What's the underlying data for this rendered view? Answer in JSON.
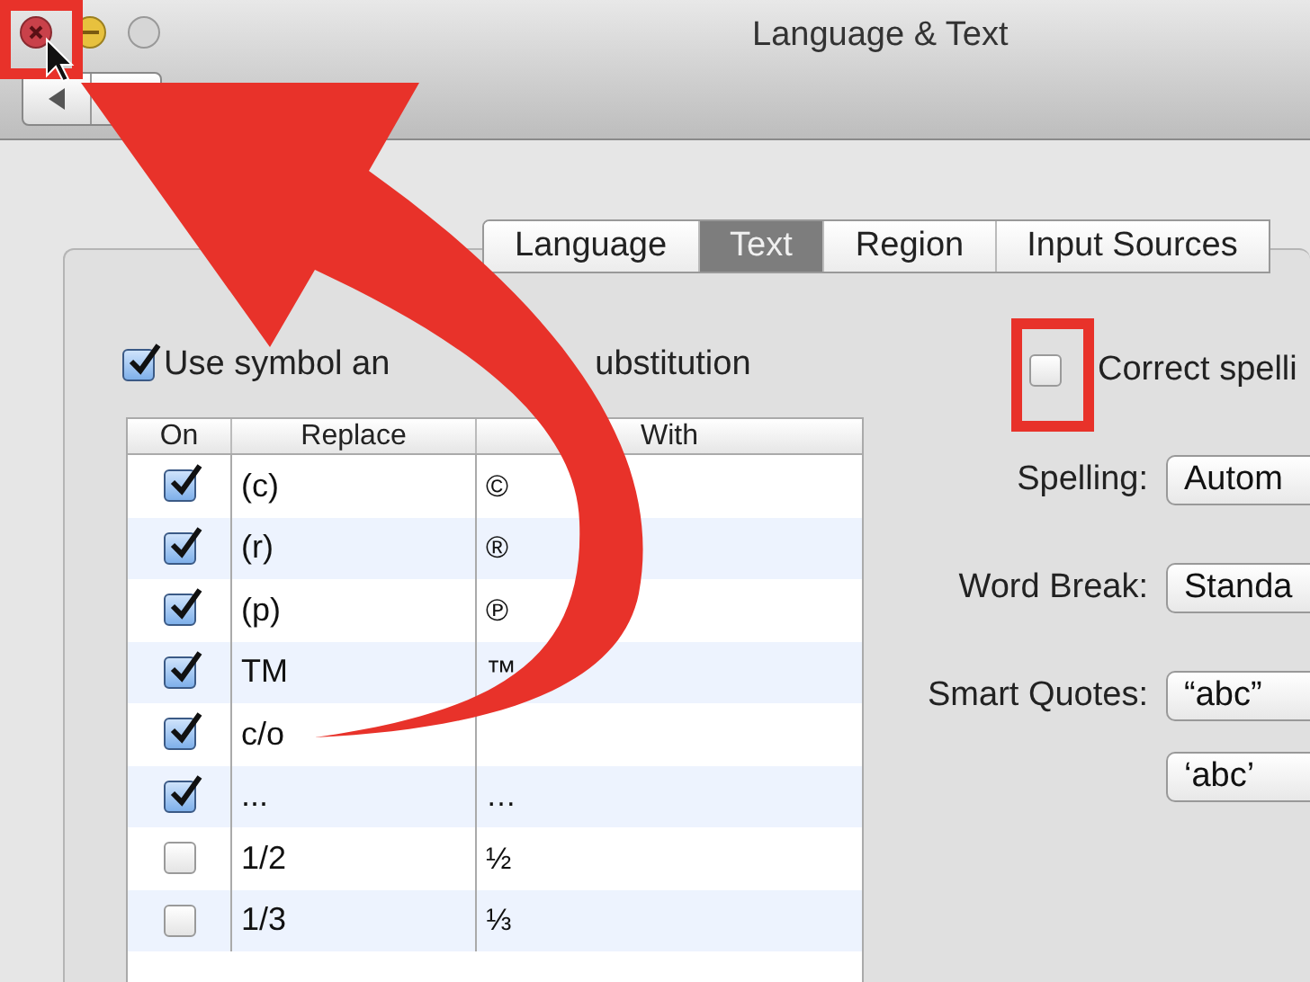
{
  "window": {
    "title": "Language & Text"
  },
  "tabs": [
    {
      "label": "Language",
      "selected": false
    },
    {
      "label": "Text",
      "selected": true
    },
    {
      "label": "Region",
      "selected": false
    },
    {
      "label": "Input Sources",
      "selected": false
    }
  ],
  "substitution": {
    "checked": true,
    "label_start": "Use symbol an",
    "label_end": "ubstitution"
  },
  "table": {
    "columns": [
      "On",
      "Replace",
      "With"
    ],
    "rows": [
      {
        "on": true,
        "replace": "(c)",
        "with": "©"
      },
      {
        "on": true,
        "replace": "(r)",
        "with": "®"
      },
      {
        "on": true,
        "replace": "(p)",
        "with": "℗"
      },
      {
        "on": true,
        "replace": "TM",
        "with": "™"
      },
      {
        "on": true,
        "replace": "c/o"
      },
      {
        "on": true,
        "replace": "...",
        "with": "…"
      },
      {
        "on": false,
        "replace": "1/2",
        "with": "½"
      },
      {
        "on": false,
        "replace": "1/3",
        "with": "⅓"
      }
    ]
  },
  "correct_spelling": {
    "checked": false,
    "label": "Correct spelli"
  },
  "settings": [
    {
      "label": "Spelling:",
      "value": "Autom"
    },
    {
      "label": "Word Break:",
      "value": "Standa"
    },
    {
      "label": "Smart Quotes:",
      "value": "“abc”"
    },
    {
      "value": "‘abc’"
    }
  ]
}
